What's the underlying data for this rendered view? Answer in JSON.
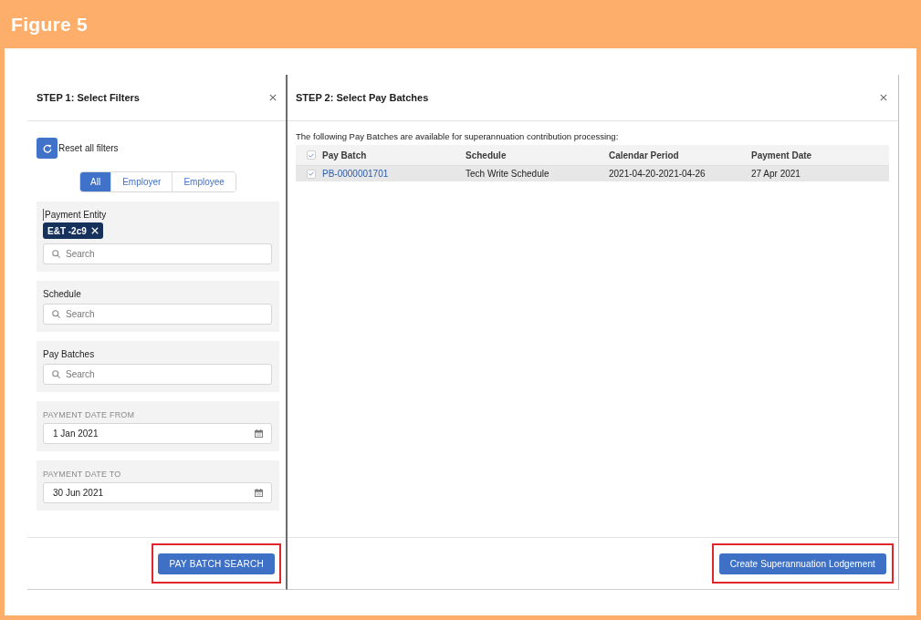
{
  "figure": {
    "title": "Figure 5"
  },
  "filters_panel": {
    "title": "STEP 1: Select Filters",
    "reset": {
      "label": "Reset all filters"
    },
    "scope_tabs": [
      {
        "label": "All",
        "selected": true
      },
      {
        "label": "Employer",
        "selected": false
      },
      {
        "label": "Employee",
        "selected": false
      }
    ],
    "filters": [
      {
        "kind": "lookup",
        "label": "Payment Entity",
        "required": true,
        "pills": [
          "E&T -2c9"
        ],
        "placeholder": "Search"
      },
      {
        "kind": "lookup",
        "label": "Schedule",
        "required": false,
        "placeholder": "Search"
      },
      {
        "kind": "lookup",
        "label": "Pay Batches",
        "required": false,
        "placeholder": "Search"
      },
      {
        "kind": "date",
        "label": "PAYMENT DATE FROM",
        "value": "1 Jan 2021"
      },
      {
        "kind": "date",
        "label": "PAYMENT DATE TO",
        "value": "30 Jun 2021"
      }
    ],
    "search_button": {
      "label": "PAY BATCH SEARCH",
      "highlighted": true
    }
  },
  "batches_panel": {
    "title": "STEP 2: Select Pay Batches",
    "intro": "The following Pay Batches are available for superannuation contribution processing:",
    "table": {
      "all_checked": true,
      "columns": [
        "Pay Batch",
        "Schedule",
        "Calendar Period",
        "Payment Date"
      ],
      "rows": [
        {
          "checked": true,
          "cells": [
            "PB-0000001701",
            "Tech Write Schedule",
            "2021-04-20-2021-04-26",
            "27 Apr 2021"
          ]
        }
      ]
    },
    "lodge_button": {
      "label": "Create Superannuation Lodgement",
      "highlighted": true
    }
  }
}
